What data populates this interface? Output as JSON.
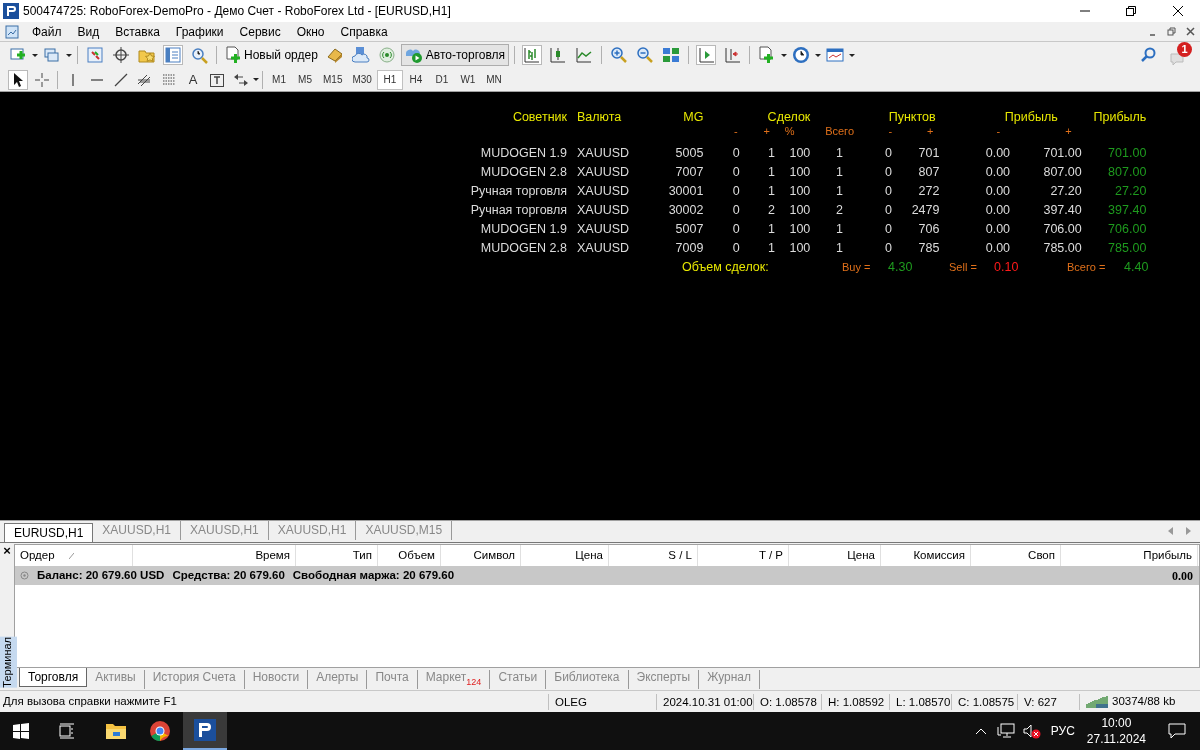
{
  "window": {
    "title": "500474725: RoboForex-DemoPro - Демо Счет - RoboForex Ltd - [EURUSD,H1]"
  },
  "menu": [
    "Файл",
    "Вид",
    "Вставка",
    "Графики",
    "Сервис",
    "Окно",
    "Справка"
  ],
  "toolbar": {
    "new_order": "Новый ордер",
    "auto_trading": {
      "label": "Авто-торговля",
      "on": true
    },
    "notifications": "1"
  },
  "drawing_tools": {
    "text_tool": "A"
  },
  "timeframes": [
    {
      "label": "M1",
      "selected": false
    },
    {
      "label": "M5",
      "selected": false
    },
    {
      "label": "M15",
      "selected": false
    },
    {
      "label": "M30",
      "selected": false
    },
    {
      "label": "H1",
      "selected": true
    },
    {
      "label": "H4",
      "selected": false
    },
    {
      "label": "D1",
      "selected": false
    },
    {
      "label": "W1",
      "selected": false
    },
    {
      "label": "MN",
      "selected": false
    }
  ],
  "chart_panel": {
    "headers": {
      "advisor": "Советник",
      "currency": "Валюта",
      "mg": "MG",
      "deals": "Сделок",
      "points": "Пунктов",
      "profit_split": "Прибыль",
      "profit": "Прибыль"
    },
    "subheaders": {
      "deals_minus": "-",
      "deals_plus": "+",
      "deals_pct": "%",
      "deals_total": "Всего",
      "points_minus": "-",
      "points_plus": "+",
      "profit_minus": "-",
      "profit_plus": "+"
    },
    "rows": [
      [
        "MUDOGEN 1.9",
        "XAUUSD",
        "5005",
        "0",
        "1",
        "100",
        "1",
        "0",
        "701",
        "0.00",
        "701.00",
        "701.00"
      ],
      [
        "MUDOGEN 2.8",
        "XAUUSD",
        "7007",
        "0",
        "1",
        "100",
        "1",
        "0",
        "807",
        "0.00",
        "807.00",
        "807.00"
      ],
      [
        "Ручная торговля",
        "XAUUSD",
        "30001",
        "0",
        "1",
        "100",
        "1",
        "0",
        "272",
        "0.00",
        "27.20",
        "27.20"
      ],
      [
        "Ручная торговля",
        "XAUUSD",
        "30002",
        "0",
        "2",
        "100",
        "2",
        "0",
        "2479",
        "0.00",
        "397.40",
        "397.40"
      ],
      [
        "MUDOGEN 1.9",
        "XAUUSD",
        "5007",
        "0",
        "1",
        "100",
        "1",
        "0",
        "706",
        "0.00",
        "706.00",
        "706.00"
      ],
      [
        "MUDOGEN 2.8",
        "XAUUSD",
        "7009",
        "0",
        "1",
        "100",
        "1",
        "0",
        "785",
        "0.00",
        "785.00",
        "785.00"
      ]
    ],
    "volume": {
      "label": "Объем сделок:",
      "buy_label": "Buy =",
      "buy": "4.30",
      "sell_label": "Sell =",
      "sell": "0.10",
      "total_label": "Всего =",
      "total": "4.40"
    }
  },
  "chart_tabs": [
    {
      "label": "EURUSD,H1",
      "selected": true
    },
    {
      "label": "XAUUSD,H1",
      "selected": false
    },
    {
      "label": "XAUUSD,H1",
      "selected": false
    },
    {
      "label": "XAUUSD,H1",
      "selected": false
    },
    {
      "label": "XAUUSD,M15",
      "selected": false
    }
  ],
  "terminal": {
    "title": "Терминал",
    "close": "×",
    "columns": [
      "Ордер",
      "Время",
      "Тип",
      "Объем",
      "Символ",
      "Цена",
      "S / L",
      "T / P",
      "Цена",
      "Комиссия",
      "Своп",
      "Прибыль"
    ],
    "balance_row": {
      "parts": [
        "Баланс: 20 679.60 USD",
        "Средства: 20 679.60",
        "Свободная маржа: 20 679.60"
      ],
      "profit": "0.00"
    },
    "tabs": [
      {
        "label": "Торговля",
        "selected": true
      },
      {
        "label": "Активы",
        "selected": false
      },
      {
        "label": "История Счета",
        "selected": false
      },
      {
        "label": "Новости",
        "selected": false
      },
      {
        "label": "Алерты",
        "selected": false
      },
      {
        "label": "Почта",
        "selected": false
      },
      {
        "label": "Маркет",
        "badge": "124",
        "selected": false
      },
      {
        "label": "Статьи",
        "selected": false
      },
      {
        "label": "Библиотека",
        "selected": false
      },
      {
        "label": "Эксперты",
        "selected": false
      },
      {
        "label": "Журнал",
        "selected": false
      }
    ]
  },
  "status_bar": {
    "help": "Для вызова справки нажмите F1",
    "cells": [
      "OLEG",
      "2024.10.31 01:00",
      "O: 1.08578",
      "H: 1.08592",
      "L: 1.08570",
      "C: 1.08575",
      "V: 627"
    ],
    "traffic": "30374/88 kb"
  },
  "taskbar": {
    "language": "РУС",
    "time": "10:00",
    "date": "27.11.2024"
  }
}
